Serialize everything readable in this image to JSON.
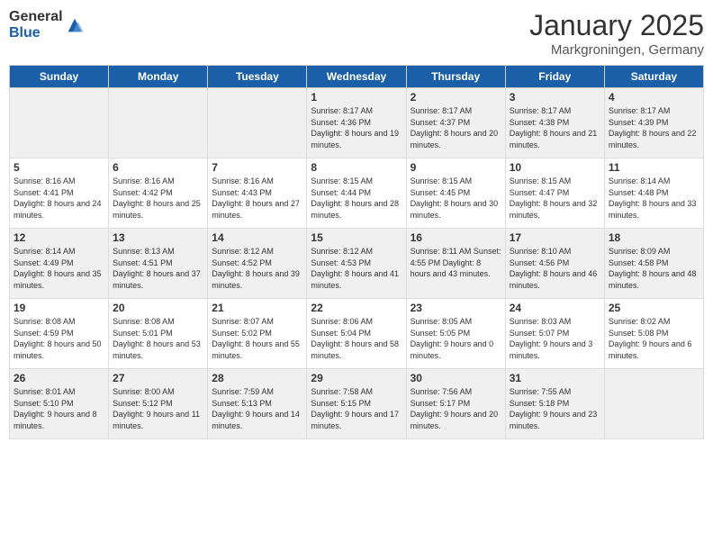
{
  "header": {
    "logo": {
      "general": "General",
      "blue": "Blue"
    },
    "title": "January 2025",
    "location": "Markgroningen, Germany"
  },
  "weekdays": [
    "Sunday",
    "Monday",
    "Tuesday",
    "Wednesday",
    "Thursday",
    "Friday",
    "Saturday"
  ],
  "weeks": [
    {
      "days": [
        {
          "num": "",
          "info": ""
        },
        {
          "num": "",
          "info": ""
        },
        {
          "num": "",
          "info": ""
        },
        {
          "num": "1",
          "info": "Sunrise: 8:17 AM\nSunset: 4:36 PM\nDaylight: 8 hours\nand 19 minutes."
        },
        {
          "num": "2",
          "info": "Sunrise: 8:17 AM\nSunset: 4:37 PM\nDaylight: 8 hours\nand 20 minutes."
        },
        {
          "num": "3",
          "info": "Sunrise: 8:17 AM\nSunset: 4:38 PM\nDaylight: 8 hours\nand 21 minutes."
        },
        {
          "num": "4",
          "info": "Sunrise: 8:17 AM\nSunset: 4:39 PM\nDaylight: 8 hours\nand 22 minutes."
        }
      ]
    },
    {
      "days": [
        {
          "num": "5",
          "info": "Sunrise: 8:16 AM\nSunset: 4:41 PM\nDaylight: 8 hours\nand 24 minutes."
        },
        {
          "num": "6",
          "info": "Sunrise: 8:16 AM\nSunset: 4:42 PM\nDaylight: 8 hours\nand 25 minutes."
        },
        {
          "num": "7",
          "info": "Sunrise: 8:16 AM\nSunset: 4:43 PM\nDaylight: 8 hours\nand 27 minutes."
        },
        {
          "num": "8",
          "info": "Sunrise: 8:15 AM\nSunset: 4:44 PM\nDaylight: 8 hours\nand 28 minutes."
        },
        {
          "num": "9",
          "info": "Sunrise: 8:15 AM\nSunset: 4:45 PM\nDaylight: 8 hours\nand 30 minutes."
        },
        {
          "num": "10",
          "info": "Sunrise: 8:15 AM\nSunset: 4:47 PM\nDaylight: 8 hours\nand 32 minutes."
        },
        {
          "num": "11",
          "info": "Sunrise: 8:14 AM\nSunset: 4:48 PM\nDaylight: 8 hours\nand 33 minutes."
        }
      ]
    },
    {
      "days": [
        {
          "num": "12",
          "info": "Sunrise: 8:14 AM\nSunset: 4:49 PM\nDaylight: 8 hours\nand 35 minutes."
        },
        {
          "num": "13",
          "info": "Sunrise: 8:13 AM\nSunset: 4:51 PM\nDaylight: 8 hours\nand 37 minutes."
        },
        {
          "num": "14",
          "info": "Sunrise: 8:12 AM\nSunset: 4:52 PM\nDaylight: 8 hours\nand 39 minutes."
        },
        {
          "num": "15",
          "info": "Sunrise: 8:12 AM\nSunset: 4:53 PM\nDaylight: 8 hours\nand 41 minutes."
        },
        {
          "num": "16",
          "info": "Sunrise: 8:11 AM\nSunset: 4:55 PM\nDaylight: 8 hours\nand 43 minutes."
        },
        {
          "num": "17",
          "info": "Sunrise: 8:10 AM\nSunset: 4:56 PM\nDaylight: 8 hours\nand 46 minutes."
        },
        {
          "num": "18",
          "info": "Sunrise: 8:09 AM\nSunset: 4:58 PM\nDaylight: 8 hours\nand 48 minutes."
        }
      ]
    },
    {
      "days": [
        {
          "num": "19",
          "info": "Sunrise: 8:08 AM\nSunset: 4:59 PM\nDaylight: 8 hours\nand 50 minutes."
        },
        {
          "num": "20",
          "info": "Sunrise: 8:08 AM\nSunset: 5:01 PM\nDaylight: 8 hours\nand 53 minutes."
        },
        {
          "num": "21",
          "info": "Sunrise: 8:07 AM\nSunset: 5:02 PM\nDaylight: 8 hours\nand 55 minutes."
        },
        {
          "num": "22",
          "info": "Sunrise: 8:06 AM\nSunset: 5:04 PM\nDaylight: 8 hours\nand 58 minutes."
        },
        {
          "num": "23",
          "info": "Sunrise: 8:05 AM\nSunset: 5:05 PM\nDaylight: 9 hours\nand 0 minutes."
        },
        {
          "num": "24",
          "info": "Sunrise: 8:03 AM\nSunset: 5:07 PM\nDaylight: 9 hours\nand 3 minutes."
        },
        {
          "num": "25",
          "info": "Sunrise: 8:02 AM\nSunset: 5:08 PM\nDaylight: 9 hours\nand 6 minutes."
        }
      ]
    },
    {
      "days": [
        {
          "num": "26",
          "info": "Sunrise: 8:01 AM\nSunset: 5:10 PM\nDaylight: 9 hours\nand 8 minutes."
        },
        {
          "num": "27",
          "info": "Sunrise: 8:00 AM\nSunset: 5:12 PM\nDaylight: 9 hours\nand 11 minutes."
        },
        {
          "num": "28",
          "info": "Sunrise: 7:59 AM\nSunset: 5:13 PM\nDaylight: 9 hours\nand 14 minutes."
        },
        {
          "num": "29",
          "info": "Sunrise: 7:58 AM\nSunset: 5:15 PM\nDaylight: 9 hours\nand 17 minutes."
        },
        {
          "num": "30",
          "info": "Sunrise: 7:56 AM\nSunset: 5:17 PM\nDaylight: 9 hours\nand 20 minutes."
        },
        {
          "num": "31",
          "info": "Sunrise: 7:55 AM\nSunset: 5:18 PM\nDaylight: 9 hours\nand 23 minutes."
        },
        {
          "num": "",
          "info": ""
        }
      ]
    }
  ]
}
